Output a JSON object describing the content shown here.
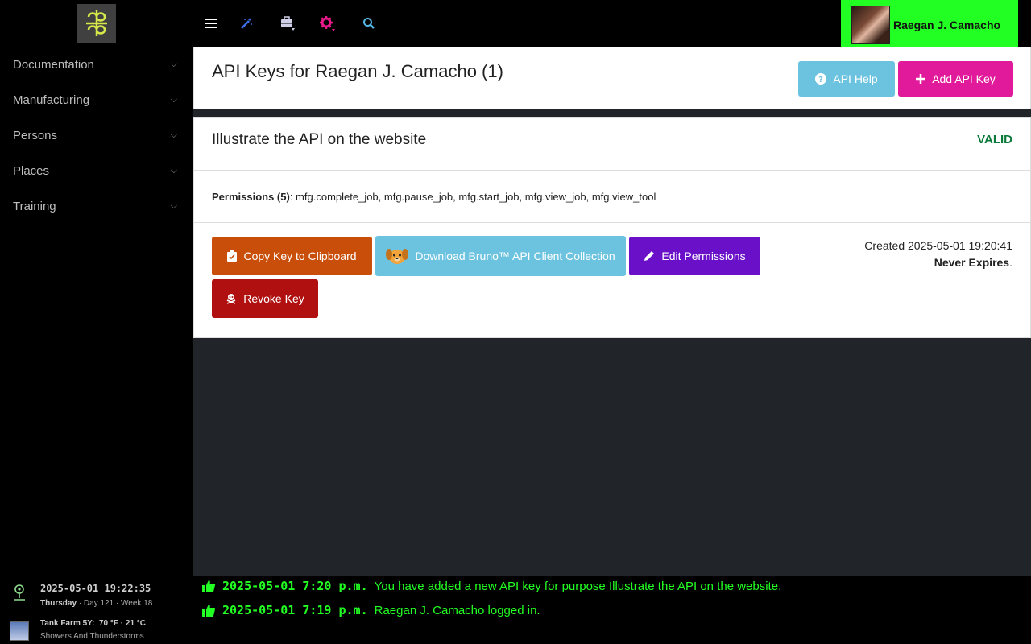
{
  "sidebar": {
    "items": [
      {
        "label": "Documentation"
      },
      {
        "label": "Manufacturing"
      },
      {
        "label": "Persons"
      },
      {
        "label": "Places"
      },
      {
        "label": "Training"
      }
    ],
    "clock": {
      "datetime": "2025-05-01 19:22:35",
      "weekday": "Thursday",
      "day": "Day 121",
      "week": "Week 18"
    },
    "weather": {
      "location": "Tank Farm 5Y:",
      "temp": "70 °F · 21 °C",
      "desc": "Showers And Thunderstorms"
    }
  },
  "header": {
    "user_name": "Raegan J. Camacho"
  },
  "page": {
    "title": "API Keys for Raegan J. Camacho (1)",
    "help_label": "API Help",
    "add_label": "Add API Key"
  },
  "key": {
    "purpose": "Illustrate the API on the website",
    "status": "VALID",
    "permissions_label": "Permissions (5)",
    "permissions": ": mfg.complete_job, mfg.pause_job, mfg.start_job, mfg.view_job, mfg.view_tool",
    "copy_label": "Copy Key to Clipboard",
    "bruno_label": "Download Bruno™ API Client Collection",
    "edit_label": "Edit Permissions",
    "revoke_label": "Revoke Key",
    "created": "Created 2025-05-01 19:20:41",
    "expires": "Never Expires",
    "expires_suffix": "."
  },
  "log": [
    {
      "ts": "2025-05-01 7:20 p.m.",
      "msg": "You have added a new API key for purpose Illustrate the API on the website."
    },
    {
      "ts": "2025-05-01 7:19 p.m.",
      "msg": "Raegan J. Camacho logged in."
    }
  ],
  "colors": {
    "accent_green": "#22ff22",
    "valid": "#0a7a3a",
    "help_btn": "#6cc3e0",
    "add_btn": "#e01a9a",
    "copy_btn": "#c84e0a",
    "edit_btn": "#6a10c8",
    "revoke_btn": "#b01010"
  }
}
